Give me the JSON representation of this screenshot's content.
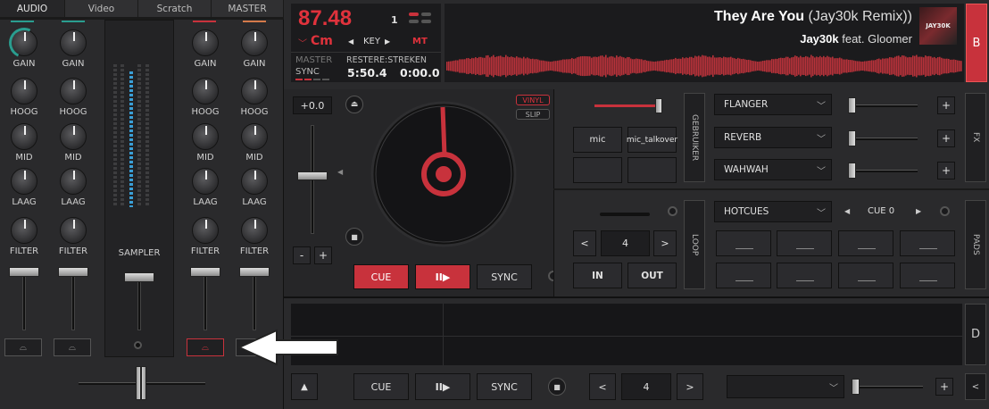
{
  "mixer": {
    "tabs": [
      "AUDIO",
      "Video",
      "Scratch",
      "MASTER"
    ],
    "knob_labels": [
      "GAIN",
      "HOOG",
      "MID",
      "LAAG",
      "FILTER"
    ],
    "sampler_label": "SAMPLER",
    "marker_colors": [
      "#2a9d8f",
      "#2a9d8f",
      "#c8323c",
      "#d47a4a"
    ]
  },
  "deck": {
    "bpm": "87.48",
    "key": "Cm",
    "key_label": "KEY",
    "mt_label": "MT",
    "beat_num": "1",
    "title": "They Are You",
    "title_remix": "(Jay30k Remix))",
    "artist": "Jay30k",
    "feat": "feat. Gloomer",
    "cover_text": "JAY30K",
    "deck_letter": "B",
    "master_label": "MASTER",
    "sync_label": "SYNC",
    "time_labels": "RESTERE:STREKEN",
    "remaining": "5:50.4",
    "elapsed": "0:00.0",
    "pitch_value": "+0.0",
    "vinyl_label": "VINYL",
    "slip_label": "SLIP",
    "minus": "-",
    "plus": "+",
    "cue": "CUE",
    "play": "II▶",
    "sync": "SYNC"
  },
  "sampler": {
    "pad1": "mic",
    "pad2": "mic_talkover",
    "gebruiker": "GEBRUIKER"
  },
  "fx": {
    "label": "FX",
    "effects": [
      "FLANGER",
      "REVERB",
      "WAHWAH"
    ],
    "plus": "+"
  },
  "loop": {
    "label": "LOOP",
    "value": "4",
    "in": "IN",
    "out": "OUT",
    "prev": "<",
    "next": ">"
  },
  "pads": {
    "label": "PADS",
    "mode": "HOTCUES",
    "cue_display": "CUE 0"
  },
  "deckD": {
    "letter": "D",
    "cue": "CUE",
    "play": "II▶",
    "sync": "SYNC",
    "loop_value": "4",
    "prev": "<",
    "next": ">",
    "plus": "+",
    "collapse": "<",
    "eject": "▲"
  },
  "colors": {
    "accent": "#c8323c",
    "teal": "#2a9d8f",
    "blue_vu": "#3aa0d8"
  }
}
